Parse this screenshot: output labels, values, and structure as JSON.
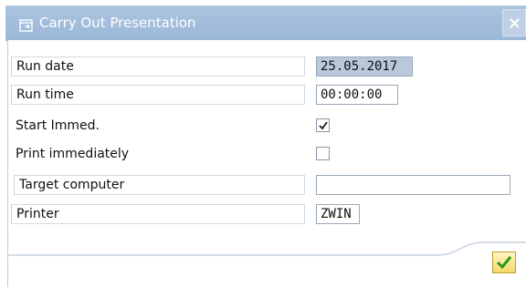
{
  "window": {
    "title": "Carry Out Presentation",
    "title_icon": "dialog-icon",
    "close_icon": "close-icon"
  },
  "form": {
    "run_date": {
      "label": "Run date",
      "value": "25.05.2017"
    },
    "run_time": {
      "label": "Run time",
      "value": "00:00:00"
    },
    "start_immed": {
      "label": "Start Immed.",
      "checked": true
    },
    "print_immediately": {
      "label": "Print immediately",
      "checked": false
    },
    "target_computer": {
      "label": "Target computer",
      "value": ""
    },
    "printer": {
      "label": "Printer",
      "value": "ZWIN"
    }
  },
  "footer": {
    "ok_icon": "checkmark-icon"
  },
  "colors": {
    "titlebar": "#a9c3df",
    "selected_field": "#b9c8da",
    "ok_button": "#f3d86a"
  }
}
